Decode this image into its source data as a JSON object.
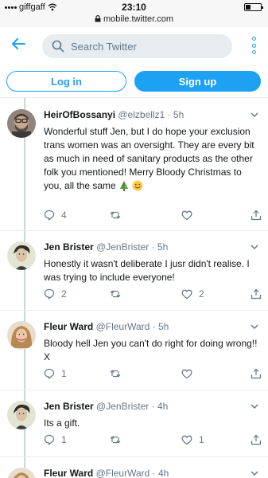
{
  "status_bar": {
    "carrier": "giffgaff",
    "time": "23:10",
    "url": "mobile.twitter.com"
  },
  "header": {
    "search_placeholder": "Search Twitter"
  },
  "auth": {
    "login_label": "Log in",
    "signup_label": "Sign up"
  },
  "colors": {
    "accent": "#1da1f2",
    "muted": "#657786",
    "line": "#e6ecf0"
  },
  "tweets": [
    {
      "name": "HeirOfBossanyi",
      "handle": "@elzbellz1",
      "time": "· 5h",
      "text": "Wonderful stuff Jen, but I do hope your exclusion trans women was an oversight. They are every bit as much in need of sanitary products as the other folk you mentioned! Merry Bloody Christmas to you, all the same",
      "emoji": [
        "christmas-tree",
        "smiling-face"
      ],
      "replies": "4",
      "retweets": "",
      "likes": ""
    },
    {
      "name": "Jen Brister",
      "handle": "@JenBrister",
      "time": "· 5h",
      "text": "Honestly it wasn't deliberate I jusr didn't realise. I was trying to include everyone!",
      "replies": "2",
      "retweets": "",
      "likes": "2"
    },
    {
      "name": "Fleur Ward",
      "handle": "@FleurWard",
      "time": "· 5h",
      "text": "Bloody hell Jen you can't do right for doing wrong!! X",
      "replies": "1",
      "retweets": "",
      "likes": ""
    },
    {
      "name": "Jen Brister",
      "handle": "@JenBrister",
      "time": "· 4h",
      "text": "Its a gift.",
      "replies": "1",
      "retweets": "",
      "likes": "1"
    },
    {
      "name": "Fleur Ward",
      "handle": "@FleurWard",
      "time": "· 4h",
      "text": ""
    }
  ]
}
